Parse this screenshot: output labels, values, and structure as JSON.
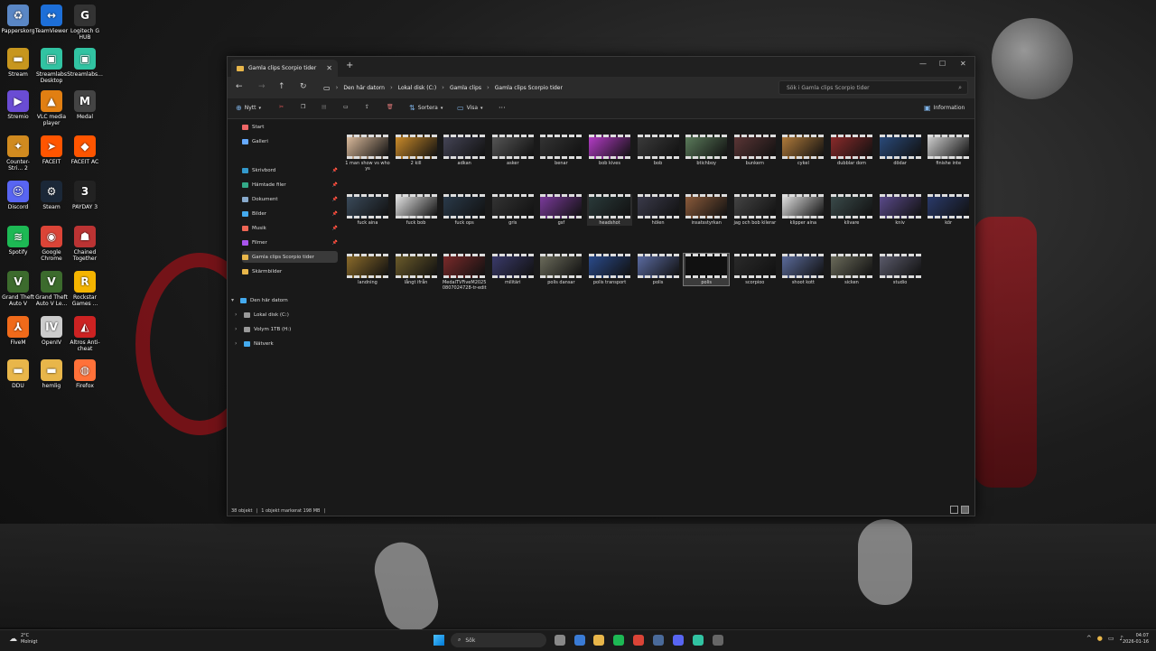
{
  "desktop_icons": [
    {
      "label": "Papperskorg",
      "color": "#5a87c5",
      "icon": "recycle-bin-icon",
      "glyph": "♻"
    },
    {
      "label": "TeamViewer",
      "color": "#1d6fd8",
      "icon": "teamviewer-icon",
      "glyph": "↔"
    },
    {
      "label": "Logitech G HUB",
      "color": "#333",
      "icon": "logitech-icon",
      "glyph": "G"
    },
    {
      "label": "Stream",
      "color": "#c7961e",
      "icon": "folder-icon",
      "glyph": "▬"
    },
    {
      "label": "Streamlabs Desktop",
      "color": "#31c3a2",
      "icon": "streamlabs-icon",
      "glyph": "▣"
    },
    {
      "label": "Streamlabs...",
      "color": "#31c3a2",
      "icon": "streamlabs-icon",
      "glyph": "▣"
    },
    {
      "label": "Stremio",
      "color": "#6a4cd4",
      "icon": "stremio-icon",
      "glyph": "▶"
    },
    {
      "label": "VLC media player",
      "color": "#e17f12",
      "icon": "vlc-icon",
      "glyph": "▲"
    },
    {
      "label": "Medal",
      "color": "#444",
      "icon": "medal-icon",
      "glyph": "M"
    },
    {
      "label": "Counter-Stri... 2",
      "color": "#d08a1f",
      "icon": "cs2-icon",
      "glyph": "✦"
    },
    {
      "label": "FACEIT",
      "color": "#ff5500",
      "icon": "faceit-icon",
      "glyph": "➤"
    },
    {
      "label": "FACEIT AC",
      "color": "#ff5500",
      "icon": "faceit-ac-icon",
      "glyph": "◆"
    },
    {
      "label": "Discord",
      "color": "#5865f2",
      "icon": "discord-icon",
      "glyph": "☺"
    },
    {
      "label": "Steam",
      "color": "#1b2838",
      "icon": "steam-icon",
      "glyph": "⚙"
    },
    {
      "label": "PAYDAY 3",
      "color": "#222",
      "icon": "payday-icon",
      "glyph": "3"
    },
    {
      "label": "Spotify",
      "color": "#1db954",
      "icon": "spotify-icon",
      "glyph": "≋"
    },
    {
      "label": "Google Chrome",
      "color": "#db4437",
      "icon": "chrome-icon",
      "glyph": "◉"
    },
    {
      "label": "Chained Together",
      "color": "#b33",
      "icon": "chained-together-icon",
      "glyph": "☗"
    },
    {
      "label": "Grand Theft Auto V",
      "color": "#3c6b2d",
      "icon": "gta-icon",
      "glyph": "V"
    },
    {
      "label": "Grand Theft Auto V Le...",
      "color": "#3c6b2d",
      "icon": "gta-icon",
      "glyph": "V"
    },
    {
      "label": "Rockstar Games ...",
      "color": "#f4b400",
      "icon": "rockstar-icon",
      "glyph": "R"
    },
    {
      "label": "FiveM",
      "color": "#f06a1a",
      "icon": "fivem-icon",
      "glyph": "⅄"
    },
    {
      "label": "OpenIV",
      "color": "#ccc",
      "icon": "openiv-icon",
      "glyph": "IV"
    },
    {
      "label": "Altros Anti-cheat",
      "color": "#c22",
      "icon": "anticheat-icon",
      "glyph": "◭"
    },
    {
      "label": "DDU",
      "color": "#e8b64a",
      "icon": "folder-icon",
      "glyph": "▬"
    },
    {
      "label": "hemlig",
      "color": "#e8b64a",
      "icon": "folder-icon",
      "glyph": "▬"
    },
    {
      "label": "Firefox",
      "color": "#ff7139",
      "icon": "firefox-icon",
      "glyph": "◍"
    }
  ],
  "window": {
    "tab_title": "Gamla clips Scorpio tider",
    "breadcrumbs": [
      "Den här datorn",
      "Lokal disk (C:)",
      "Gamla clips",
      "Gamla clips Scorpio tider"
    ],
    "search_placeholder": "Sök i Gamla clips Scorpio tider",
    "toolbar": {
      "new": "Nytt",
      "sort": "Sortera",
      "view": "Visa",
      "more": "···",
      "info": "Information"
    },
    "sidebar": [
      {
        "label": "Start",
        "color": "#e66"
      },
      {
        "label": "Galleri",
        "color": "#6af"
      },
      {
        "label": "Skrivbord",
        "color": "#39c",
        "pinned": true
      },
      {
        "label": "Hämtade filer",
        "color": "#3a8",
        "pinned": true
      },
      {
        "label": "Dokument",
        "color": "#8ac",
        "pinned": true
      },
      {
        "label": "Bilder",
        "color": "#4ae",
        "pinned": true
      },
      {
        "label": "Musik",
        "color": "#e65",
        "pinned": true
      },
      {
        "label": "Filmer",
        "color": "#a5e",
        "pinned": true
      },
      {
        "label": "Gamla clips Scorpio tider",
        "color": "#e8b64a",
        "active": true
      },
      {
        "label": "Skärmbilder",
        "color": "#e8b64a"
      },
      {
        "label": "Den här datorn",
        "color": "#4ae",
        "tree": "▾"
      },
      {
        "label": "Lokal disk (C:)",
        "color": "#999",
        "tree": "›"
      },
      {
        "label": "Volym 1TB (H:)",
        "color": "#999",
        "tree": "›"
      },
      {
        "label": "Nätverk",
        "color": "#4ae",
        "tree": "›"
      }
    ],
    "files": [
      {
        "name": "1 man show vs whoys",
        "tint": "#d9b99a"
      },
      {
        "name": "2 kill",
        "tint": "#c98a2a"
      },
      {
        "name": "adkan",
        "tint": "#445"
      },
      {
        "name": "asker",
        "tint": "#555"
      },
      {
        "name": "benar",
        "tint": "#333"
      },
      {
        "name": "bob kives",
        "tint": "#b23bc4"
      },
      {
        "name": "bob",
        "tint": "#3a3a3a"
      },
      {
        "name": "btichboy",
        "tint": "#5a7a5a"
      },
      {
        "name": "bunkern",
        "tint": "#5a3535"
      },
      {
        "name": "cykel",
        "tint": "#b07a3a"
      },
      {
        "name": "dubblar dom",
        "tint": "#8a2a2a"
      },
      {
        "name": "dödar",
        "tint": "#2a4a7a"
      },
      {
        "name": "finishe inte",
        "tint": "#ccc"
      },
      {
        "name": "fuck aina",
        "tint": "#3a4a5a"
      },
      {
        "name": "fuck bob",
        "tint": "#e0e0e0"
      },
      {
        "name": "fuck ops",
        "tint": "#2a3a4a"
      },
      {
        "name": "gris",
        "tint": "#333"
      },
      {
        "name": "gsf",
        "tint": "#7a3a9a"
      },
      {
        "name": "headshot",
        "tint": "#2a3a3a"
      },
      {
        "name": "hölen",
        "tint": "#3a3a4a"
      },
      {
        "name": "insatsstyrkan",
        "tint": "#8a5a3a"
      },
      {
        "name": "jag och bob kilerar",
        "tint": "#444"
      },
      {
        "name": "klipper aina",
        "tint": "#ddd"
      },
      {
        "name": "klivare",
        "tint": "#3a4a4a"
      },
      {
        "name": "kniv",
        "tint": "#5a4a8a"
      },
      {
        "name": "kör",
        "tint": "#2a3a6a"
      },
      {
        "name": "landning",
        "tint": "#8a6a2a"
      },
      {
        "name": "långt ifrån",
        "tint": "#6a5a2a"
      },
      {
        "name": "MedalTVFiveM20250807024728-tr-edit",
        "tint": "#7a2a2a"
      },
      {
        "name": "militäri",
        "tint": "#3a3a6a"
      },
      {
        "name": "polis dansar",
        "tint": "#6a6a5a"
      },
      {
        "name": "polis transport",
        "tint": "#2a4a8a"
      },
      {
        "name": "polis",
        "tint": "#5a6aa0"
      },
      {
        "name": "polis",
        "tint": "#111"
      },
      {
        "name": "scorpioo",
        "tint": "#2a2a2a"
      },
      {
        "name": "shoot kott",
        "tint": "#5a6a9a"
      },
      {
        "name": "sicken",
        "tint": "#6a6a5a"
      },
      {
        "name": "studio",
        "tint": "#5a5a6a"
      }
    ],
    "status": {
      "count": "38 objekt",
      "selected": "1 objekt markerat 198 MB"
    }
  },
  "taskbar": {
    "weather_temp": "2°C",
    "weather_desc": "Molnigt",
    "search_label": "Sök",
    "time": "04:07",
    "date": "2026-01-16",
    "apps": [
      {
        "icon": "task-view-icon",
        "color": "#888"
      },
      {
        "icon": "widgets-icon",
        "color": "#3a7bd5"
      },
      {
        "icon": "file-explorer-icon",
        "color": "#e8b64a"
      },
      {
        "icon": "spotify-icon",
        "color": "#1db954"
      },
      {
        "icon": "chrome-icon",
        "color": "#db4437"
      },
      {
        "icon": "steam-icon",
        "color": "#4a6a9a"
      },
      {
        "icon": "discord-icon",
        "color": "#5865f2"
      },
      {
        "icon": "streamlabs-icon",
        "color": "#31c3a2"
      },
      {
        "icon": "medal-icon",
        "color": "#666"
      }
    ]
  }
}
